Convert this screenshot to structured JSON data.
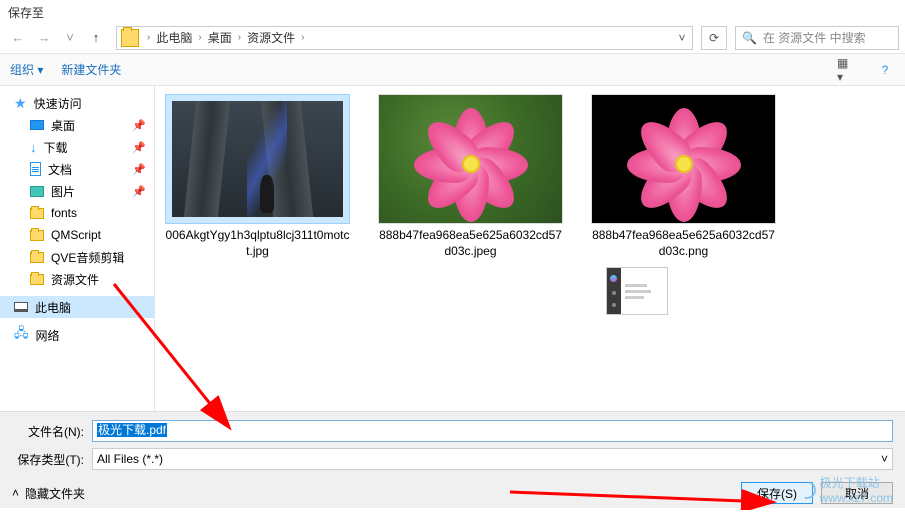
{
  "window": {
    "title": "保存至"
  },
  "nav": {
    "path_root": "此电脑",
    "path_items": [
      "桌面",
      "资源文件"
    ],
    "search_placeholder": "在 资源文件 中搜索"
  },
  "toolbar": {
    "organize": "组织",
    "new_folder": "新建文件夹"
  },
  "sidebar": {
    "quick_access": "快速访问",
    "desktop": "桌面",
    "downloads": "下载",
    "documents": "文档",
    "pictures": "图片",
    "folders": [
      "fonts",
      "QMScript",
      "QVE音频剪辑",
      "资源文件"
    ],
    "this_pc": "此电脑",
    "network": "网络"
  },
  "files": [
    {
      "name": "006AkgtYgy1h3qlptu8lcj311t0motct.jpg"
    },
    {
      "name": "888b47fea968ea5e625a6032cd57d03c.jpeg"
    },
    {
      "name": "888b47fea968ea5e625a6032cd57d03c.png"
    }
  ],
  "footer": {
    "filename_label": "文件名(N):",
    "filename_value": "极光下载.pdf",
    "filetype_label": "保存类型(T):",
    "filetype_value": "All Files (*.*)",
    "hide_folders": "隐藏文件夹",
    "save_btn": "保存(S)",
    "cancel_btn": "取消"
  },
  "watermark": {
    "text": "极光下载站",
    "url": "www.xz7.com"
  }
}
